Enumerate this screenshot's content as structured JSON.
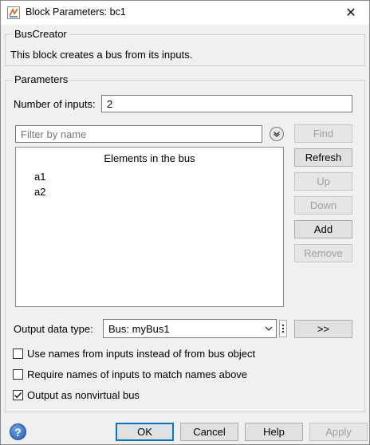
{
  "window": {
    "title": "Block Parameters: bc1"
  },
  "block": {
    "group_label": "BusCreator",
    "description": "This block creates a bus from its inputs."
  },
  "parameters": {
    "group_label": "Parameters",
    "number_of_inputs_label": "Number of inputs:",
    "number_of_inputs_value": "2",
    "filter_placeholder": "Filter by name",
    "elements_header": "Elements in the bus",
    "elements": [
      "a1",
      "a2"
    ],
    "buttons": {
      "find": "Find",
      "refresh": "Refresh",
      "up": "Up",
      "down": "Down",
      "add": "Add",
      "remove": "Remove",
      "assistant": ">>"
    },
    "output_data_type_label": "Output data type:",
    "output_data_type_value": "Bus: myBus1",
    "checkboxes": [
      {
        "label": "Use names from inputs instead of from bus object",
        "checked": false
      },
      {
        "label": "Require names of inputs to match names above",
        "checked": false
      },
      {
        "label": "Output as nonvirtual bus",
        "checked": true
      }
    ]
  },
  "footer": {
    "help_icon": "?",
    "ok": "OK",
    "cancel": "Cancel",
    "help": "Help",
    "apply": "Apply"
  },
  "colors": {
    "focus_blue": "#0078d7",
    "disabled_text": "#a0a0a0"
  }
}
